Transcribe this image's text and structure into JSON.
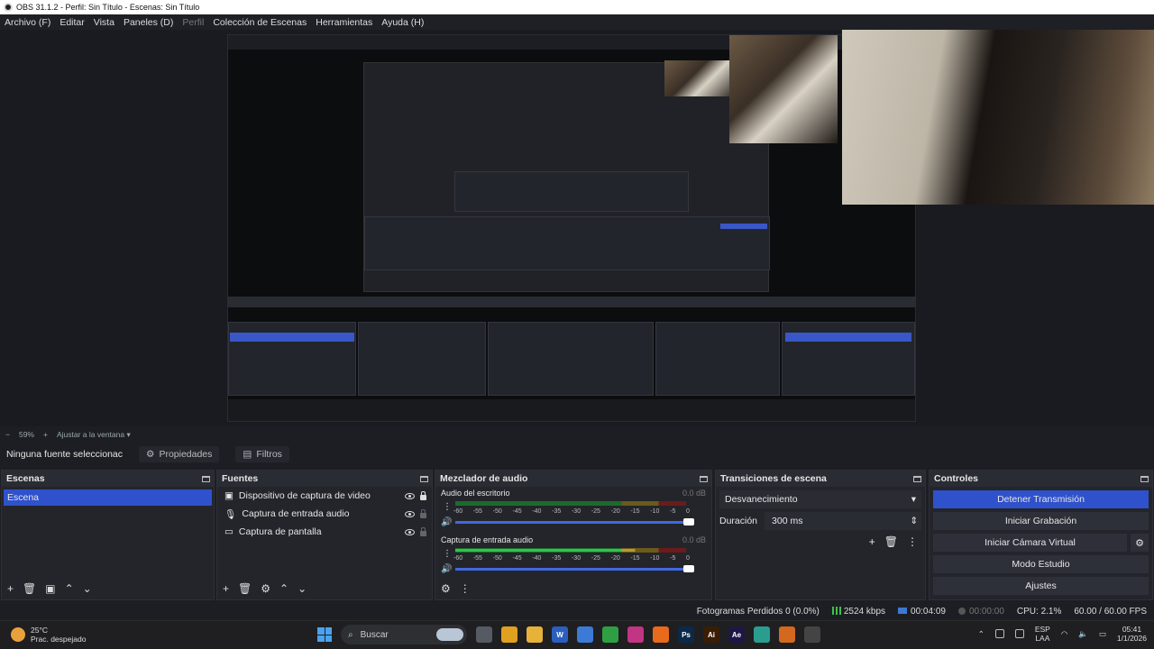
{
  "window": {
    "title": "OBS 31.1.2 - Perfil: Sin Título - Escenas: Sin Título"
  },
  "menu": [
    "Archivo (F)",
    "Editar",
    "Vista",
    "Paneles (D)",
    "Perfil",
    "Colección de Escenas",
    "Herramientas",
    "Ayuda (H)"
  ],
  "zoom": {
    "minus": "−",
    "value": "59%",
    "plus": "+",
    "fit": "Ajustar a la ventana"
  },
  "source_toolbar": {
    "no_source": "Ninguna fuente seleccionac",
    "properties": "Propiedades",
    "filters": "Filtros"
  },
  "scenes": {
    "title": "Escenas",
    "items": [
      "Escena"
    ]
  },
  "sources": {
    "title": "Fuentes",
    "items": [
      {
        "name": "Dispositivo de captura de video",
        "icon": "camera-icon",
        "locked": true
      },
      {
        "name": "Captura de entrada audio",
        "icon": "mic-icon",
        "locked": false
      },
      {
        "name": "Captura de pantalla",
        "icon": "monitor-icon",
        "locked": false
      }
    ]
  },
  "mixer": {
    "title": "Mezclador de audio",
    "channels": [
      {
        "name": "Audio del escritorio",
        "db": "0.0 dB",
        "level": 0.0
      },
      {
        "name": "Captura de entrada audio",
        "db": "0.0 dB",
        "level": 0.78
      }
    ],
    "ticks": [
      "-60",
      "-55",
      "-50",
      "-45",
      "-40",
      "-35",
      "-30",
      "-25",
      "-20",
      "-15",
      "-10",
      "-5",
      "0"
    ]
  },
  "transitions": {
    "title": "Transiciones de escena",
    "selected": "Desvanecimiento",
    "duration_label": "Duración",
    "duration_value": "300 ms"
  },
  "controls": {
    "title": "Controles",
    "stop_stream": "Detener Transmisión",
    "start_record": "Iniciar Grabación",
    "virtual_cam": "Iniciar Cámara Virtual",
    "studio_mode": "Modo Estudio",
    "settings": "Ajustes"
  },
  "status": {
    "dropped": "Fotogramas Perdidos 0 (0.0%)",
    "bitrate": "2524 kbps",
    "stream_time": "00:04:09",
    "rec_time": "00:00:00",
    "cpu": "CPU: 2.1%",
    "fps": "60.00 / 60.00 FPS"
  },
  "taskbar": {
    "temp": "25°C",
    "weather": "Prac. despejado",
    "search": "Buscar",
    "lang1": "ESP",
    "lang2": "LAA",
    "time": "05:41",
    "date": "1/1/2026",
    "apps": [
      {
        "label": "",
        "color": "#555a63"
      },
      {
        "label": "",
        "color": "#e0a020"
      },
      {
        "label": "",
        "color": "#e7b23a"
      },
      {
        "label": "W",
        "color": "#2b5fbf"
      },
      {
        "label": "",
        "color": "#3b7bd6"
      },
      {
        "label": "",
        "color": "#2ea043"
      },
      {
        "label": "",
        "color": "#c13584"
      },
      {
        "label": "",
        "color": "#e86a1c"
      },
      {
        "label": "Ps",
        "color": "#0b2a4a"
      },
      {
        "label": "Ai",
        "color": "#3a1d05"
      },
      {
        "label": "Ae",
        "color": "#1d1745"
      },
      {
        "label": "",
        "color": "#2a9d8f"
      },
      {
        "label": "",
        "color": "#d2691e"
      },
      {
        "label": "",
        "color": "#444"
      }
    ]
  },
  "colors": {
    "accent": "#2f51cc",
    "meter_green": "#33c24a",
    "meter_yellow": "#b89a2b",
    "meter_red": "#b83232"
  }
}
